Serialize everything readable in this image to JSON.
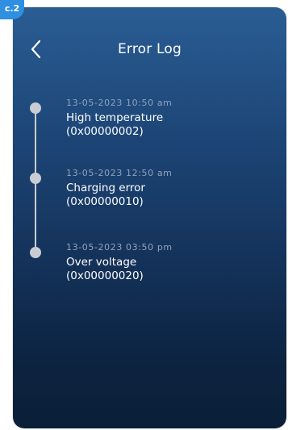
{
  "badge": "c.2",
  "header": {
    "title": "Error Log",
    "back_icon": "chevron-left-icon"
  },
  "errors": [
    {
      "timestamp": "13-05-2023  10:50 am",
      "message": "High temperature",
      "code": "(0x00000002)"
    },
    {
      "timestamp": "13-05-2023  12:50 am",
      "message": "Charging error",
      "code": "(0x00000010)"
    },
    {
      "timestamp": "13-05-2023  03:50 pm",
      "message": "Over voltage",
      "code": "(0x00000020)"
    }
  ]
}
